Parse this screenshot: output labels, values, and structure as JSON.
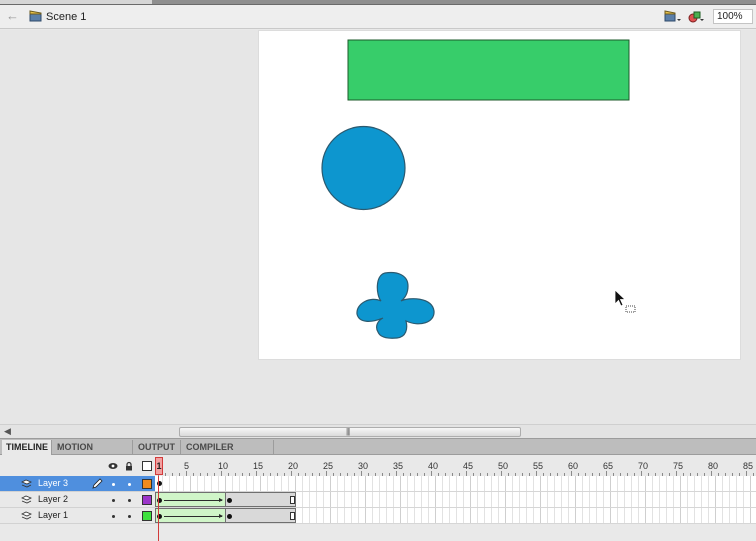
{
  "edit_bar": {
    "scene_label": "Scene 1",
    "zoom": "100%",
    "icons": [
      "back-arrow-icon",
      "scene-clapper-icon",
      "edit-scene-icon",
      "edit-symbol-icon"
    ]
  },
  "stage": {
    "background": "#ffffff",
    "shapes": [
      {
        "name": "rectangle",
        "fill": "#37cd6a",
        "stroke": "#1b5a2a"
      },
      {
        "name": "circle",
        "fill": "#0d96cf",
        "stroke": "#2b5a70"
      },
      {
        "name": "clover",
        "fill": "#0d96cf",
        "stroke": "#2b5a70"
      }
    ]
  },
  "panel_tabs": [
    {
      "label": "TIMELINE",
      "active": true
    },
    {
      "label": "MOTION EDITOR",
      "active": false
    },
    {
      "label": "OUTPUT",
      "active": false
    },
    {
      "label": "COMPILER ERRORS",
      "active": false
    }
  ],
  "timeline": {
    "ruler": [
      "5",
      "10",
      "15",
      "20",
      "25",
      "30",
      "35",
      "40",
      "45",
      "50",
      "55",
      "60",
      "65",
      "70",
      "75",
      "80",
      "85"
    ],
    "current_frame": "1",
    "layers": [
      {
        "name": "Layer 3",
        "selected": true,
        "color": "#f08a1c",
        "frames": "1",
        "keyframes": [
          "1"
        ]
      },
      {
        "name": "Layer 2",
        "selected": false,
        "color": "#9b35c9",
        "frames": "20",
        "keyframes": [
          "1",
          "10"
        ],
        "tween": "1-10"
      },
      {
        "name": "Layer 1",
        "selected": false,
        "color": "#3ee03e",
        "frames": "20",
        "keyframes": [
          "1",
          "10"
        ],
        "tween": "1-10"
      }
    ],
    "header_icons": [
      "eye-icon",
      "lock-icon",
      "outline-icon"
    ]
  },
  "colors": {
    "accent_selected": "#4f8fde",
    "playhead": "#d23a3a",
    "tween_fill": "#d0f5c8"
  }
}
